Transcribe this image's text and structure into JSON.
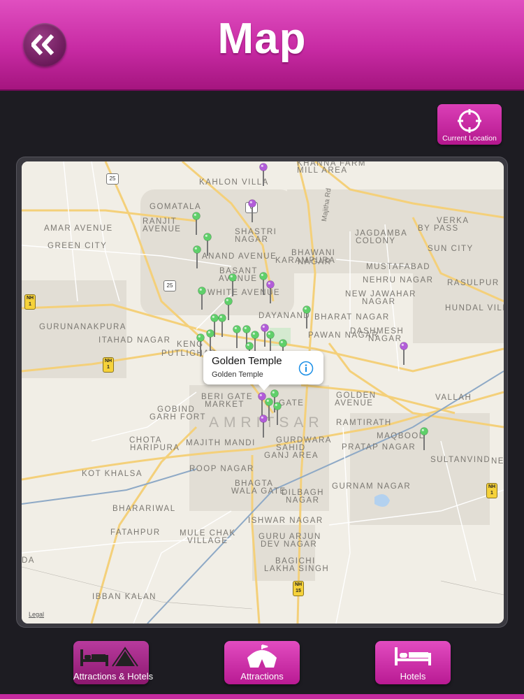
{
  "header": {
    "title": "Map"
  },
  "current_location": {
    "label": "Current Location"
  },
  "map": {
    "legal": "Legal",
    "city": "AMRITSAR",
    "road_label": "Majitha Rd",
    "labels": [
      "KHANNA FARM",
      "MILL AREA",
      "KAHLON VILLA",
      "GOMATALA",
      "RANJIT",
      "AVENUE",
      "AMAR AVENUE",
      "GREEN CITY",
      "SHASTRI",
      "NAGAR",
      "JAGDAMBA",
      "COLONY",
      "VERKA",
      "BY PASS",
      "SUN CITY",
      "KARAMPURA",
      "BHAWANI",
      "NAGAR",
      "BASANT",
      "AVENUE",
      "MUSTAFABAD",
      "NEHRU NAGAR",
      "RASULPUR",
      "HUNDAL VILL",
      "NEW JAWAHAR",
      "NAGAR",
      "GURUNANAKPURA",
      "ITAHAD NAGAR",
      "DAYANAND",
      "BHARAT NAGAR",
      "PAWAN NAGAR",
      "DASHMESH",
      "NAGAR",
      "BERI GATE",
      "MARKET",
      "GOBIND",
      "GARH FORT",
      "GOLDEN",
      "AVENUE",
      "VALLAH",
      "CHOTA",
      "HARIPURA",
      "MAJITH MANDI",
      "MAQBOOL",
      "PRATAP NAGAR",
      "SULTANVIND",
      "SAHID",
      "GANJ AREA",
      "ROOP NAGAR",
      "KOT KHALSA",
      "BHAGTA",
      "WALA GATE",
      "GURNAM NAGAR",
      "BHARARIWAL",
      "DILBAGH",
      "NAGAR",
      "ISHWAR NAGAR",
      "FATAHPUR",
      "MULE CHAK",
      "VILLAGE",
      "GURU ARJUN",
      "DEV NAGAR",
      "BAGICHI",
      "LAKHA SINGH",
      "IBBAN KALAN",
      "NE",
      "DA",
      "GURDWARA",
      "RAMTIRATH",
      "PUTLIGHAR",
      "KENG",
      "GATE",
      "WHITE AVENUE",
      "ANAND AVENUE"
    ],
    "route_shields": [
      "25",
      "25",
      "NH 1",
      "NH 1",
      "NH 1",
      "NH 15",
      "6"
    ],
    "callout": {
      "title": "Golden Temple",
      "subtitle": "Golden Temple"
    },
    "pin_colors": {
      "attraction": "#5fd06a",
      "hotel": "#b25cd9"
    }
  },
  "tabs": [
    {
      "label": "Attractions & Hotels",
      "icon": "bed-and-tent-icon",
      "active": true
    },
    {
      "label": "Attractions",
      "icon": "tent-icon",
      "active": false
    },
    {
      "label": "Hotels",
      "icon": "bed-icon",
      "active": false
    }
  ]
}
